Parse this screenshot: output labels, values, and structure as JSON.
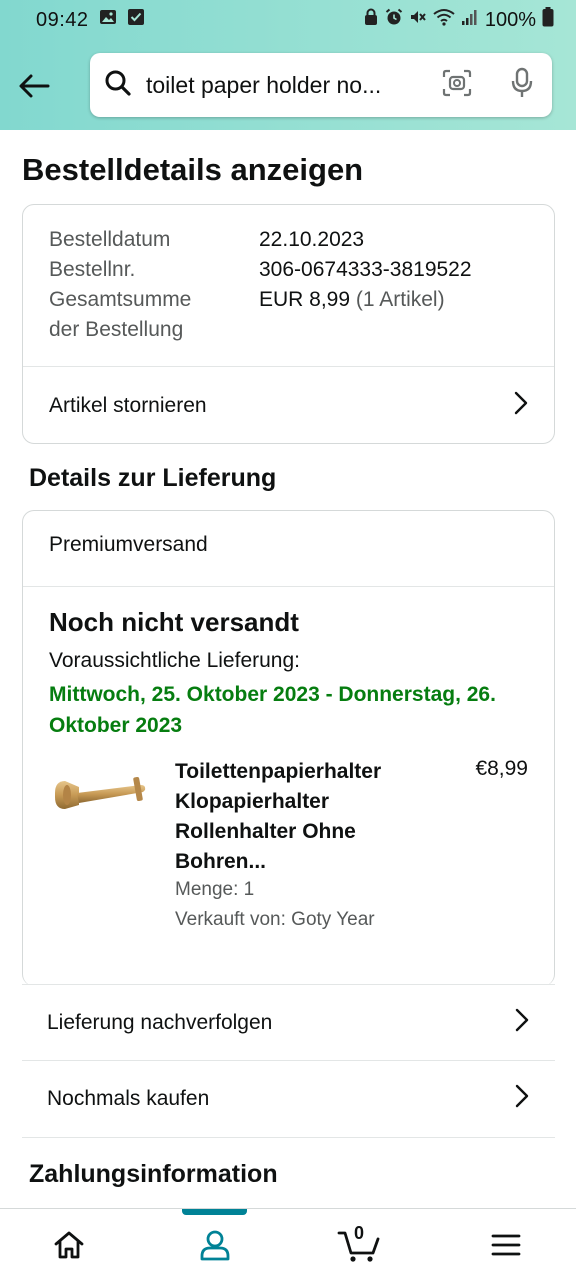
{
  "status_bar": {
    "time": "09:42",
    "battery": "100%",
    "icons": [
      "image-icon",
      "check-icon",
      "lock-icon",
      "alarm-icon",
      "mute-icon",
      "wifi-icon",
      "signal-icon",
      "battery-icon"
    ]
  },
  "search": {
    "query": "toilet paper holder no..."
  },
  "page": {
    "title": "Bestelldetails anzeigen"
  },
  "order": {
    "date_label": "Bestelldatum",
    "date_value": "22.10.2023",
    "number_label": "Bestellnr.",
    "number_value": "306-0674333-3819522",
    "total_label_1": "Gesamtsumme",
    "total_label_2": "der Bestellung",
    "total_value": "EUR 8,99",
    "total_items": "(1 Artikel)",
    "cancel_label": "Artikel stornieren"
  },
  "delivery": {
    "section_title": "Details zur Lieferung",
    "ship_type": "Premiumversand",
    "status": "Noch nicht versandt",
    "expected_label": "Voraussichtliche Lieferung:",
    "expected_date": "Mittwoch, 25. Oktober 2023 - Donnerstag, 26. Oktober 2023",
    "product": {
      "title": "Toilettenpapierhalter Klopapierhalter Rollenhalter Ohne Bohren...",
      "price": "€8,99",
      "quantity": "Menge: 1",
      "seller": "Verkauft von: Goty Year"
    },
    "track_label": "Lieferung nachverfolgen",
    "buy_again_label": "Nochmals kaufen"
  },
  "payment": {
    "section_title": "Zahlungsinformation"
  },
  "bottom_nav": {
    "cart_count": "0",
    "items": [
      "home-icon",
      "account-icon",
      "cart-icon",
      "menu-icon"
    ],
    "active_color": "#008296"
  },
  "colors": {
    "header_gradient_start": "#82d8cf",
    "header_gradient_end": "#a6e6d6",
    "delivery_green": "#067d10"
  }
}
